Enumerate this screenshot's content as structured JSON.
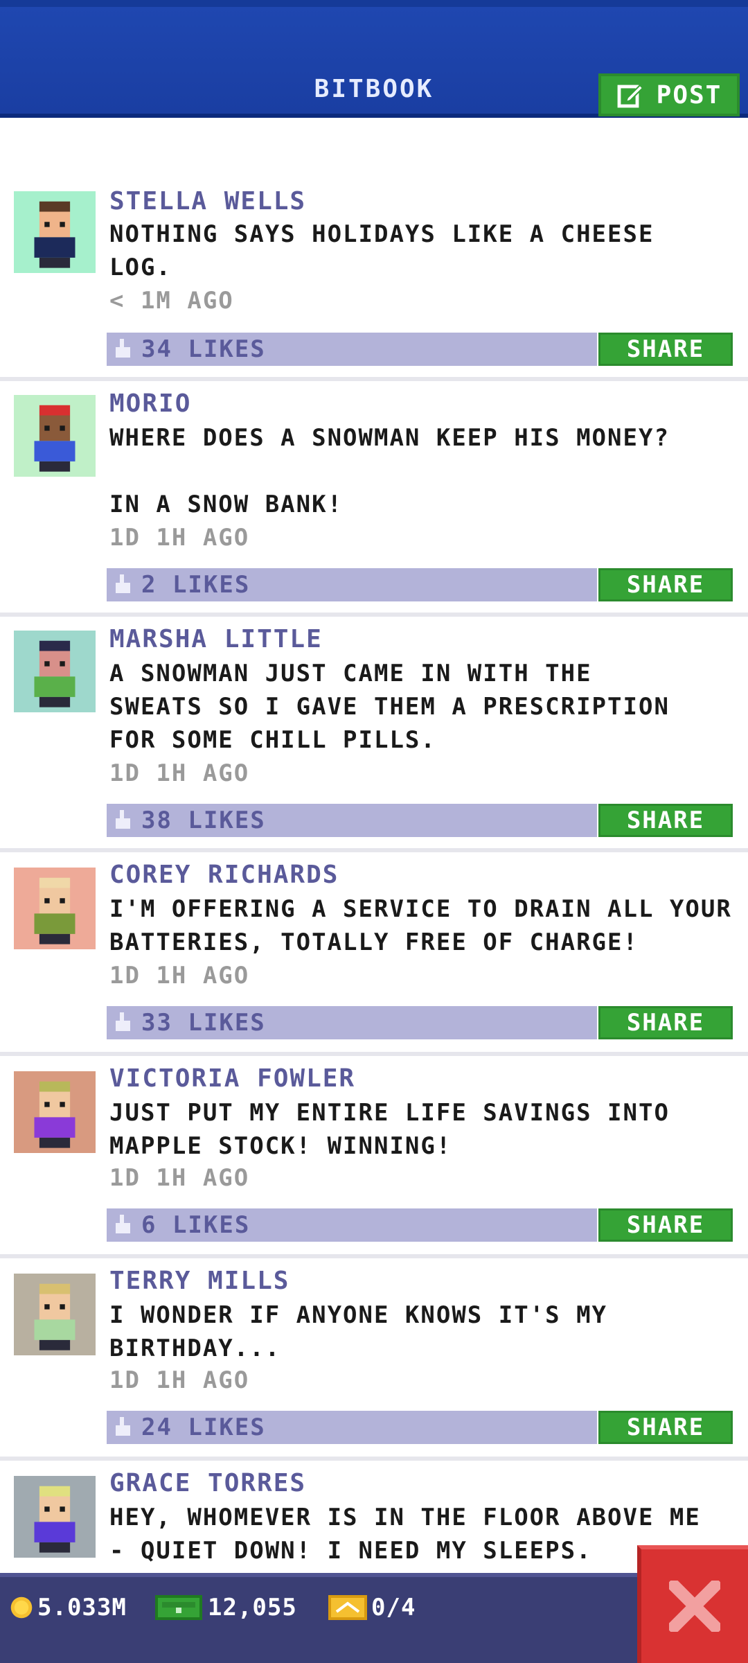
{
  "header": {
    "title": "BITBOOK",
    "post_label": "POST"
  },
  "posts": [
    {
      "author": "STELLA WELLS",
      "text": "NOTHING SAYS HOLIDAYS LIKE A CHEESE\nLOG.",
      "time": "< 1M AGO",
      "likes": "34 LIKES",
      "share": "SHARE",
      "avatar_bg": "#a6f0cc",
      "avatar_shirt": "#1c2a5a",
      "avatar_hair": "#5a3a26",
      "avatar_skin": "#f0b48a"
    },
    {
      "author": "MORIO",
      "text": "WHERE DOES A SNOWMAN KEEP HIS MONEY?\n\nIN A SNOW BANK!",
      "time": "1D 1H AGO",
      "likes": "2 LIKES",
      "share": "SHARE",
      "avatar_bg": "#c0f0c8",
      "avatar_shirt": "#3a5ad8",
      "avatar_hair": "#d83030",
      "avatar_skin": "#8a5a3a"
    },
    {
      "author": "MARSHA LITTLE",
      "text": "A SNOWMAN JUST CAME IN WITH THE\nSWEATS SO I GAVE THEM A PRESCRIPTION\nFOR SOME CHILL PILLS.",
      "time": "1D 1H AGO",
      "likes": "38 LIKES",
      "share": "SHARE",
      "avatar_bg": "#9ed8cc",
      "avatar_shirt": "#5ab04a",
      "avatar_hair": "#2a2a4a",
      "avatar_skin": "#d8908a"
    },
    {
      "author": "COREY RICHARDS",
      "text": "I'M OFFERING A SERVICE TO DRAIN ALL YOUR\nBATTERIES, TOTALLY FREE OF CHARGE!",
      "time": "1D 1H AGO",
      "likes": "33 LIKES",
      "share": "SHARE",
      "avatar_bg": "#eeaa98",
      "avatar_shirt": "#7a9a3a",
      "avatar_hair": "#f0d8a8",
      "avatar_skin": "#f0c8a0"
    },
    {
      "author": "VICTORIA FOWLER",
      "text": "JUST PUT MY ENTIRE LIFE SAVINGS INTO\nMAPPLE STOCK! WINNING!",
      "time": "1D 1H AGO",
      "likes": "6 LIKES",
      "share": "SHARE",
      "avatar_bg": "#d89a80",
      "avatar_shirt": "#8a3ad8",
      "avatar_hair": "#b8b85a",
      "avatar_skin": "#f0c8a0"
    },
    {
      "author": "TERRY MILLS",
      "text": "I WONDER IF ANYONE KNOWS IT'S MY\nBIRTHDAY...",
      "time": "1D 1H AGO",
      "likes": "24 LIKES",
      "share": "SHARE",
      "avatar_bg": "#b8b0a0",
      "avatar_shirt": "#a8d8a0",
      "avatar_hair": "#d8c070",
      "avatar_skin": "#f0c8a0"
    },
    {
      "author": "GRACE TORRES",
      "text": "HEY, WHOMEVER IS IN THE FLOOR ABOVE ME\n- QUIET DOWN! I NEED MY SLEEPS.",
      "time": "",
      "likes": "",
      "share": "",
      "avatar_bg": "#a0aab0",
      "avatar_shirt": "#5a3ad8",
      "avatar_hair": "#e0e080",
      "avatar_skin": "#f0c8a0"
    }
  ],
  "footer": {
    "coins": "5.033M",
    "bux": "12,055",
    "tickets": "0/4"
  },
  "colors": {
    "header_blue": "#1f47b0",
    "share_green": "#35a336",
    "likes_bar": "#b3b3d9",
    "author_purple": "#5a5a9a",
    "close_red": "#d93232",
    "footer_bg": "#3a3e74"
  },
  "icons": [
    "edit-icon",
    "thumb-up-icon",
    "coin-icon",
    "bux-icon",
    "ticket-icon",
    "close-icon"
  ]
}
